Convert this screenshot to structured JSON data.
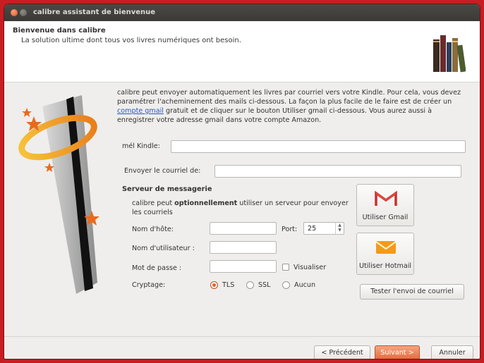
{
  "window": {
    "title": "calibre assistant de bienvenue"
  },
  "header": {
    "title": "Bienvenue dans calibre",
    "subtitle": "La solution ultime dont tous vos livres numériques ont besoin."
  },
  "description": {
    "part1": "calibre peut envoyer automatiquement les livres par courriel vers votre Kindle. Pour cela, vous devez paramétrer l'acheminement des mails ci-dessous. La façon la plus facile de le faire est de créer un ",
    "link": "compte gmail",
    "part2": " gratuit et de cliquer sur le bouton Utiliser gmail ci-dessous. Vous aurez aussi à enregistrer votre adresse gmail dans votre compte Amazon."
  },
  "fields": {
    "kindle_label": "mél Kindle:",
    "kindle_value": "",
    "send_from_label": "Envoyer le courriel de:",
    "send_from_value": ""
  },
  "server": {
    "title": "Serveur de messagerie",
    "explanation_pre": "calibre peut ",
    "explanation_bold": "optionnellement",
    "explanation_post": " utiliser un serveur pour envoyer les courriels",
    "host_label": "Nom d'hôte:",
    "host_value": "",
    "port_label": "Port:",
    "port_value": "25",
    "user_label": "Nom d'utilisateur :",
    "user_value": "",
    "pass_label": "Mot de passe :",
    "pass_value": "",
    "show_label": "Visualiser",
    "encryption_label": "Cryptage:",
    "enc_options": [
      "TLS",
      "SSL",
      "Aucun"
    ],
    "enc_selected": "TLS"
  },
  "buttons": {
    "gmail": "Utiliser Gmail",
    "hotmail": "Utiliser Hotmail",
    "test": "Tester l'envoi de courriel",
    "previous": "< Précédent",
    "next": "Suivant >",
    "cancel": "Annuler"
  },
  "colors": {
    "accent": "#e2693a",
    "link": "#2a56b8",
    "titlebar": "#3b3a36"
  },
  "icons": {
    "books": "books-icon",
    "gmail": "gmail-icon",
    "hotmail": "envelope-icon",
    "logo": "calibre-logo"
  }
}
